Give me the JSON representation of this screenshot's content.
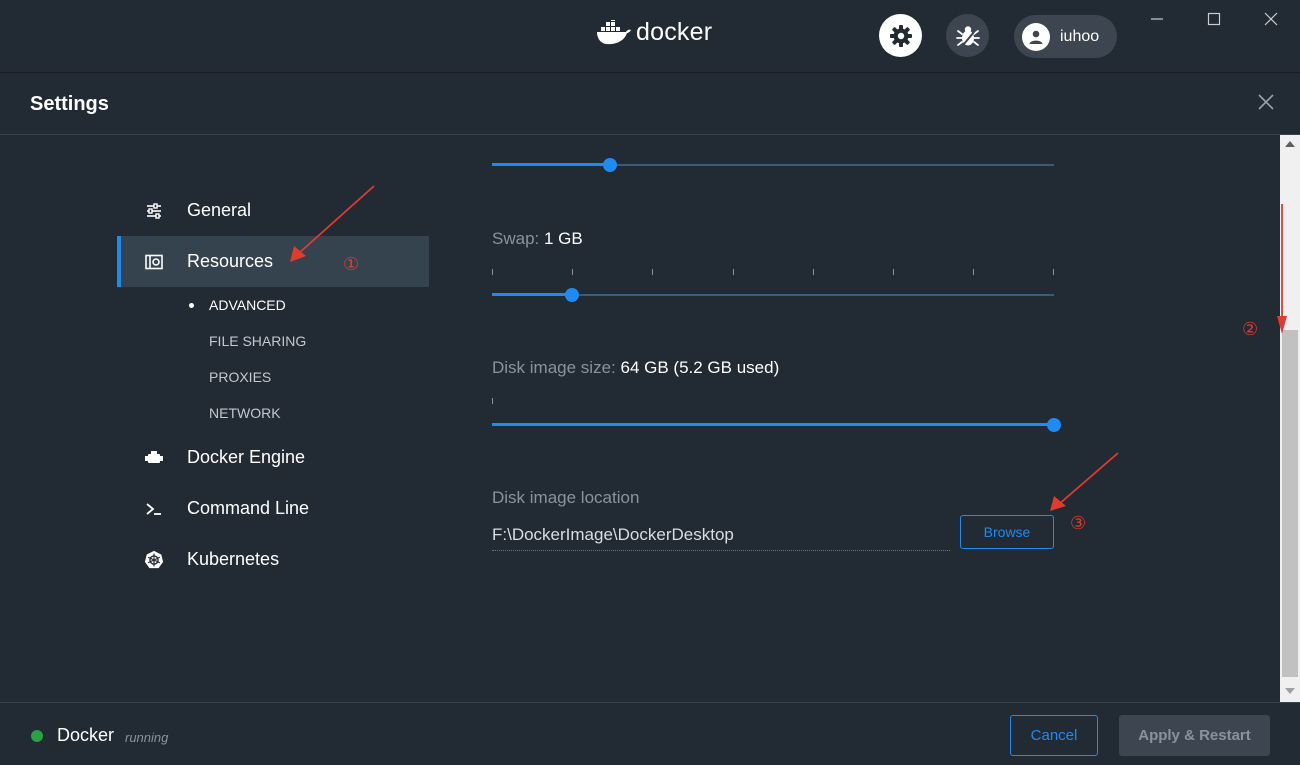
{
  "app": {
    "brand": "docker",
    "user_name": "iuhoo"
  },
  "settings": {
    "title": "Settings"
  },
  "sidebar": {
    "items": [
      {
        "label": "General",
        "icon": "sliders-icon"
      },
      {
        "label": "Resources",
        "icon": "resources-icon",
        "active": true
      },
      {
        "label": "Docker Engine",
        "icon": "engine-icon"
      },
      {
        "label": "Command Line",
        "icon": "terminal-icon"
      },
      {
        "label": "Kubernetes",
        "icon": "kubernetes-icon"
      }
    ],
    "sub_items": [
      {
        "label": "ADVANCED",
        "active": true
      },
      {
        "label": "FILE SHARING"
      },
      {
        "label": "PROXIES"
      },
      {
        "label": "NETWORK"
      }
    ]
  },
  "resources": {
    "memory_slider_fraction": 0.21,
    "swap": {
      "label": "Swap:",
      "value": "1 GB",
      "slider_fraction": 0.143
    },
    "disk_size": {
      "label": "Disk image size:",
      "value": "64 GB (5.2 GB used)",
      "slider_fraction": 1.0
    },
    "disk_location": {
      "label": "Disk image location",
      "value": "F:\\DockerImage\\DockerDesktop",
      "browse_label": "Browse"
    }
  },
  "annotations": {
    "one": "①",
    "two": "②",
    "three": "③"
  },
  "footer": {
    "status_name": "Docker",
    "status_text": "running",
    "cancel_label": "Cancel",
    "apply_label": "Apply & Restart"
  },
  "colors": {
    "accent": "#1d8bf1",
    "status_running": "#27a343",
    "annotation": "#e33a2e"
  }
}
